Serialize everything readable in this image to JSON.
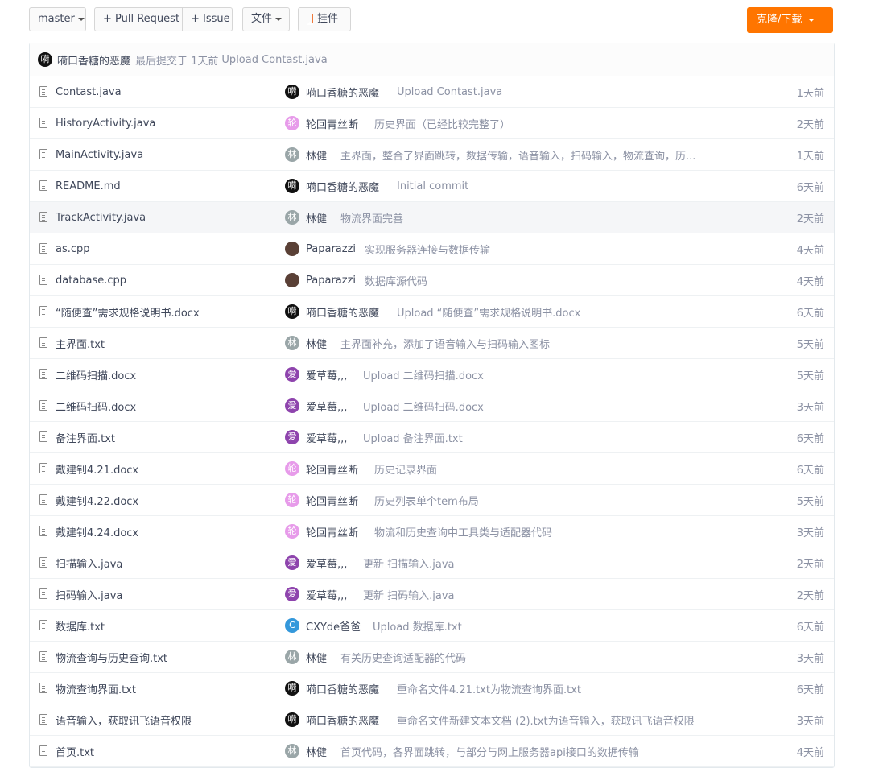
{
  "toolbar": {
    "branch": "master",
    "pull_request": "+ Pull Request",
    "issue": "+ Issue",
    "files": "文件",
    "widget": "挂件",
    "clone": "克隆/下载"
  },
  "last_commit": {
    "author": "嗬口香糖的恶魔",
    "meta": "最后提交于 1天前",
    "message": "Upload Contast.java",
    "avatar": {
      "glyph": "嗬",
      "color": "#111111"
    }
  },
  "colors": {
    "accent": "#ff7500",
    "black_avatar": "#111111",
    "pink_avatar": "#e79bea",
    "grey_avatar": "#9aa6a8",
    "purple_avatar": "#8e44ad",
    "blue_avatar": "#3498db"
  },
  "files": [
    {
      "name": "Contast.java",
      "avatar": "嗬",
      "avatar_color": "#111111",
      "author": "嗬口香糖的恶魔",
      "message": "Upload Contast.java",
      "time": "1天前"
    },
    {
      "name": "HistoryActivity.java",
      "avatar": "轮",
      "avatar_color": "#e79bea",
      "author": "轮回青丝断",
      "message": "历史界面（已经比较完整了）",
      "time": "2天前"
    },
    {
      "name": "MainActivity.java",
      "avatar": "林",
      "avatar_color": "#9aa6a8",
      "author": "林健",
      "message": "主界面，整合了界面跳转，数据传输，语音输入，扫码输入，物流查询，历...",
      "time": "1天前"
    },
    {
      "name": "README.md",
      "avatar": "嗬",
      "avatar_color": "#111111",
      "author": "嗬口香糖的恶魔",
      "message": "Initial commit",
      "time": "6天前"
    },
    {
      "name": "TrackActivity.java",
      "avatar": "林",
      "avatar_color": "#9aa6a8",
      "author": "林健",
      "message": "物流界面完善",
      "time": "2天前"
    },
    {
      "name": "as.cpp",
      "avatar": "",
      "avatar_color": "#5a4036",
      "author": "Paparazzi",
      "message": "实现服务器连接与数据传输",
      "time": "4天前"
    },
    {
      "name": "database.cpp",
      "avatar": "",
      "avatar_color": "#5a4036",
      "author": "Paparazzi",
      "message": "数据库源代码",
      "time": "4天前"
    },
    {
      "name": "“随便查”需求规格说明书.docx",
      "avatar": "嗬",
      "avatar_color": "#111111",
      "author": "嗬口香糖的恶魔",
      "message": "Upload “随便查”需求规格说明书.docx",
      "time": "6天前"
    },
    {
      "name": "主界面.txt",
      "avatar": "林",
      "avatar_color": "#9aa6a8",
      "author": "林健",
      "message": "主界面补充，添加了语音输入与扫码输入图标",
      "time": "5天前"
    },
    {
      "name": "二维码扫描.docx",
      "avatar": "爱",
      "avatar_color": "#8e44ad",
      "author": "爱草莓,,,",
      "message": "Upload 二维码扫描.docx",
      "time": "5天前"
    },
    {
      "name": "二维码扫码.docx",
      "avatar": "爱",
      "avatar_color": "#8e44ad",
      "author": "爱草莓,,,",
      "message": "Upload 二维码扫码.docx",
      "time": "3天前"
    },
    {
      "name": "备注界面.txt",
      "avatar": "爱",
      "avatar_color": "#8e44ad",
      "author": "爱草莓,,,",
      "message": "Upload 备注界面.txt",
      "time": "6天前"
    },
    {
      "name": "戴建钊4.21.docx",
      "avatar": "轮",
      "avatar_color": "#e79bea",
      "author": "轮回青丝断",
      "message": "历史记录界面",
      "time": "6天前"
    },
    {
      "name": "戴建钊4.22.docx",
      "avatar": "轮",
      "avatar_color": "#e79bea",
      "author": "轮回青丝断",
      "message": "历史列表单个tem布局",
      "time": "5天前"
    },
    {
      "name": "戴建钊4.24.docx",
      "avatar": "轮",
      "avatar_color": "#e79bea",
      "author": "轮回青丝断",
      "message": "物流和历史查询中工具类与适配器代码",
      "time": "3天前"
    },
    {
      "name": "扫描输入.java",
      "avatar": "爱",
      "avatar_color": "#8e44ad",
      "author": "爱草莓,,,",
      "message": "更新 扫描输入.java",
      "time": "2天前"
    },
    {
      "name": "扫码输入.java",
      "avatar": "爱",
      "avatar_color": "#8e44ad",
      "author": "爱草莓,,,",
      "message": "更新 扫码输入.java",
      "time": "2天前"
    },
    {
      "name": "数据库.txt",
      "avatar": "C",
      "avatar_color": "#3498db",
      "author": "CXYde爸爸",
      "message": "Upload 数据库.txt",
      "time": "6天前"
    },
    {
      "name": "物流查询与历史查询.txt",
      "avatar": "林",
      "avatar_color": "#9aa6a8",
      "author": "林健",
      "message": "有关历史查询适配器的代码",
      "time": "3天前"
    },
    {
      "name": "物流查询界面.txt",
      "avatar": "嗬",
      "avatar_color": "#111111",
      "author": "嗬口香糖的恶魔",
      "message": "重命名文件4.21.txt为物流查询界面.txt",
      "time": "6天前"
    },
    {
      "name": "语音输入，获取讯飞语音权限",
      "avatar": "嗬",
      "avatar_color": "#111111",
      "author": "嗬口香糖的恶魔",
      "message": "重命名文件新建文本文档 (2).txt为语音输入，获取讯飞语音权限",
      "time": "3天前"
    },
    {
      "name": "首页.txt",
      "avatar": "林",
      "avatar_color": "#9aa6a8",
      "author": "林健",
      "message": "首页代码，各界面跳转，与部分与网上服务器api接口的数据传输",
      "time": "4天前"
    }
  ]
}
